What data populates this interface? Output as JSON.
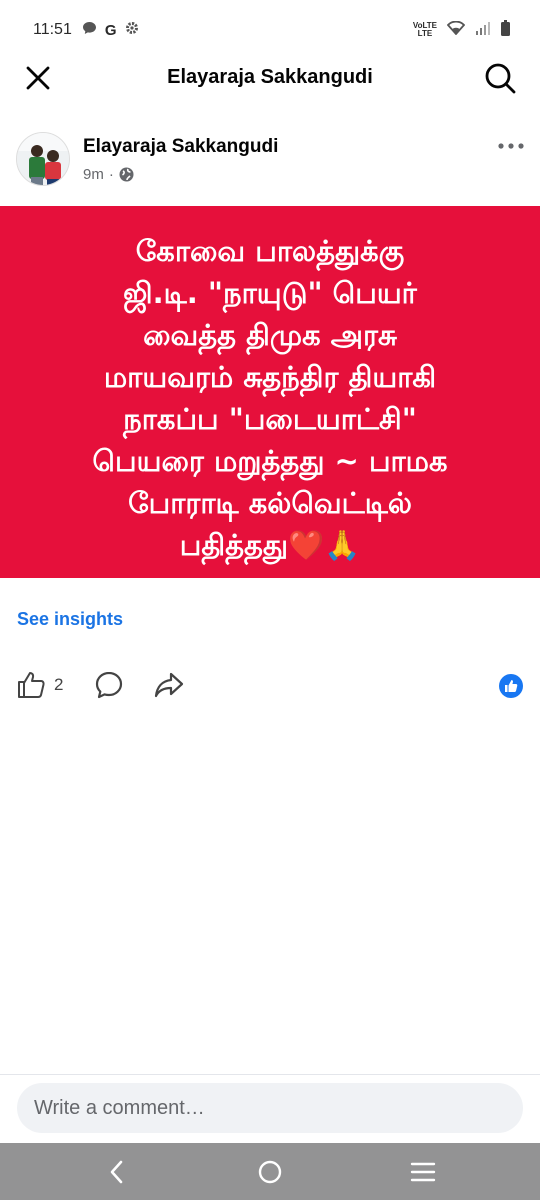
{
  "status_bar": {
    "time": "11:51",
    "g_label": "G",
    "volte_top": "VoLTE",
    "volte_bottom": "LTE",
    "icons": [
      "chat-bubble-icon",
      "google-icon",
      "gear-icon",
      "volte-icon",
      "wifi-icon",
      "signal-icon",
      "battery-icon"
    ]
  },
  "top_bar": {
    "title": "Elayaraja Sakkangudi",
    "left_icon": "close-icon",
    "right_icon": "search-icon"
  },
  "post": {
    "author": "Elayaraja Sakkangudi",
    "time_ago": "9m",
    "separator": "·",
    "privacy_icon": "globe-icon",
    "background_color": "#e6103b",
    "text": "கோவை பாலத்துக்கு\nஜி.டி. \"நாயுடு\" பெயர்\nவைத்த திமுக அரசு\nமாயவரம் சுதந்திர தியாகி\nநாகப்ப \"படையாட்சி\"\nபெயரை மறுத்தது ~ பாமக\nபோராடி கல்வெட்டில்\nபதித்தது❤️🙏"
  },
  "insights_link": "See insights",
  "actions": {
    "like_count": "2",
    "icons": [
      "thumbs-up-icon",
      "comment-icon",
      "share-icon",
      "like-reaction-icon"
    ]
  },
  "comment": {
    "placeholder": "Write a comment…"
  },
  "nav_bar": {
    "icons": [
      "back-icon",
      "home-icon",
      "recents-icon"
    ]
  },
  "colors": {
    "accent": "#1b74e4",
    "post_bg": "#e6103b",
    "nav_bg": "#939394"
  }
}
